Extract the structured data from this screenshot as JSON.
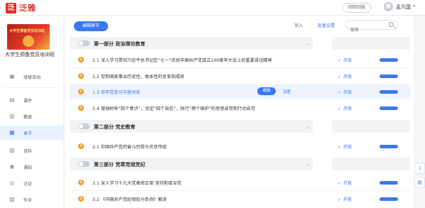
{
  "header": {
    "logo_mark": "泛",
    "logo_text": "泛雅",
    "back_button": "回到旧版",
    "username": "孟凡国",
    "caret": "▾"
  },
  "sidebar": {
    "cover_text": "大学生预备党员培训班",
    "course_title": "大学生预备党员培训班",
    "items": [
      {
        "label": "班级活动",
        "icon": "▣"
      },
      {
        "label": "课件",
        "icon": "▤"
      },
      {
        "label": "教案",
        "icon": "▥"
      },
      {
        "label": "章节",
        "icon": "▦"
      },
      {
        "label": "资料",
        "icon": "▧"
      },
      {
        "label": "通知",
        "icon": "◉"
      },
      {
        "label": "讨论",
        "icon": "◎"
      },
      {
        "label": "作业",
        "icon": "▨"
      }
    ]
  },
  "toolbar": {
    "edit_chapter": "编辑章节",
    "import": "导入",
    "batch": "批量设置",
    "search_placeholder": "搜索"
  },
  "sections": [
    {
      "title": "第一部分 政治理论教育",
      "lessons": [
        {
          "num": "1",
          "title": "1.1 深入学习贯彻习近平总书记在“七一”庆祝中国共产党成立100周年大会上的重要讲话精神",
          "status": "开放"
        },
        {
          "num": "1",
          "title": "1.2 党和国家事业历史性、根本性的变革和成就",
          "status": "开放"
        },
        {
          "num": "1",
          "title": "1.3 百年党史与中美关系",
          "status": "开放",
          "edit": "编辑",
          "settings": "设置"
        },
        {
          "num": "1",
          "title": "1.4 增强树牢“四个意识”，坚定“四个自信”，践行“两个维护”的思想自觉和行动自觉",
          "status": "开放"
        }
      ]
    },
    {
      "title": "第二部分 党史教育",
      "lessons": [
        {
          "num": "1",
          "title": "2.1 中国共产党的奋斗历程与优良传统",
          "status": "开放"
        }
      ]
    },
    {
      "title": "第三部分 党章党规党纪",
      "lessons": [
        {
          "num": "1",
          "title": "3.1 深入学习十九大党章修正案 坚持制度治党",
          "status": "开放"
        },
        {
          "num": "1",
          "title": "3.2 《中国共产党纪律处分条例》解读",
          "status": "开放"
        }
      ]
    }
  ],
  "icons": {
    "check": "✓",
    "caret_up": "︿",
    "download": "⇩",
    "note": "▤"
  },
  "colors": {
    "brand_red": "#e02d20",
    "accent_blue": "#3a78f2",
    "lesson_dot": "#f39a1e"
  }
}
